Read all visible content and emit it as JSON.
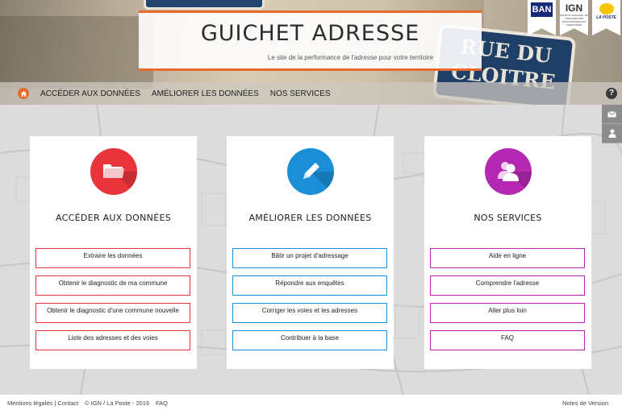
{
  "header": {
    "title": "GUICHET ADRESSE",
    "subtitle": "Le site de la performance de l'adresse pour votre territoire",
    "street_sign": "RUE DU CLOITRE",
    "logos": [
      {
        "name": "ban-logo",
        "text": "BAN"
      },
      {
        "name": "ign-logo",
        "text": "IGN",
        "fine": "INSTITUT NATIONAL DE L'INFORMATION GÉOGRAPHIQUE ET FORESTIÈRE"
      },
      {
        "name": "laposte-logo",
        "text": "LA POSTE"
      }
    ]
  },
  "nav": {
    "home_icon": "home-icon",
    "items": [
      "ACCÉDER AUX DONNÉES",
      "AMÉLIORER LES DONNÉES",
      "NOS SERVICES"
    ],
    "help": "?"
  },
  "side_icons": [
    "mail-icon",
    "user-icon"
  ],
  "cards": [
    {
      "title": "ACCÉDER AUX DONNÉES",
      "icon": "folder-icon",
      "color": "#e8353b",
      "links": [
        "Extraire les données",
        "Obtenir le diagnostic de ma commune",
        "Obtenir le diagnostic d'une commune nouvelle",
        "Liste des adresses et des voies"
      ]
    },
    {
      "title": "AMÉLIORER LES DONNÉES",
      "icon": "pencil-icon",
      "color": "#1a8fd8",
      "links": [
        "Bâtir un projet d'adressage",
        "Répondre aux enquêtes",
        "Corriger les voies et les adresses",
        "Contribuer à la base"
      ]
    },
    {
      "title": "NOS SERVICES",
      "icon": "users-icon",
      "color": "#b428b2",
      "links": [
        "Aide en ligne",
        "Comprendre l'adresse",
        "Aller plus loin",
        "FAQ"
      ]
    }
  ],
  "footer": {
    "legal": "Mentions légales | Contact",
    "copyright": "© IGN / La Poste - 2016",
    "faq": "FAQ",
    "release_notes": "Notes de Version"
  }
}
